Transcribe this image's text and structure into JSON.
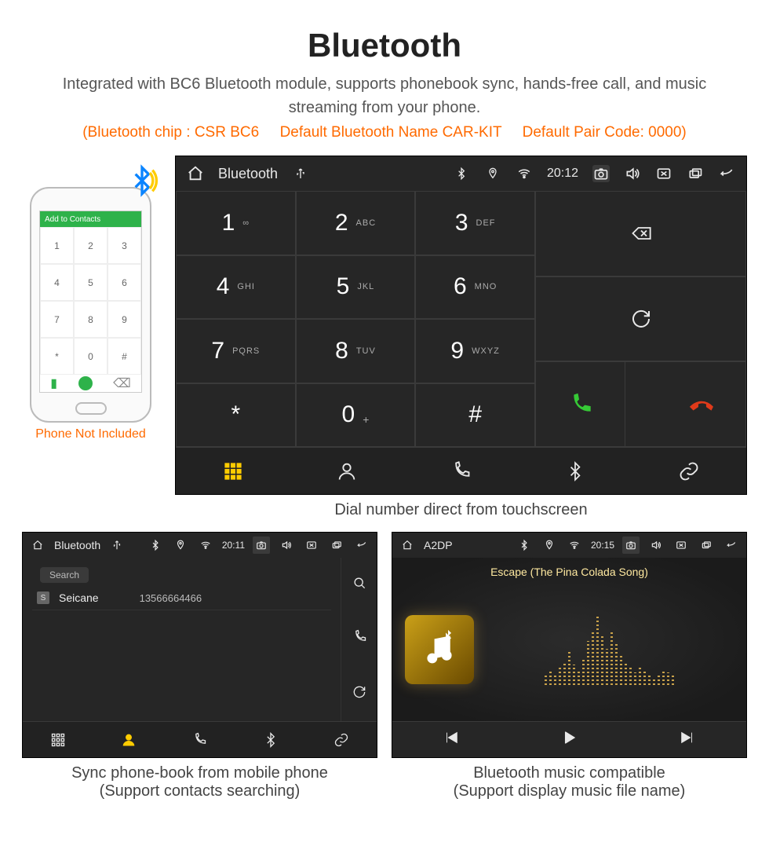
{
  "header": {
    "title": "Bluetooth",
    "subtitle": "Integrated with BC6 Bluetooth module, supports phonebook sync, hands-free call, and music streaming from your phone.",
    "specline": "(Bluetooth chip : CSR BC6     Default Bluetooth Name CAR-KIT     Default Pair Code: 0000)"
  },
  "phone_mock": {
    "top_label": "Add to Contacts",
    "keys": [
      "1",
      "2",
      "3",
      "4",
      "5",
      "6",
      "7",
      "8",
      "9",
      "*",
      "0",
      "#"
    ],
    "caption": "Phone Not Included"
  },
  "dialer": {
    "statusbar": {
      "title": "Bluetooth",
      "time": "20:12"
    },
    "keys": [
      {
        "num": "1",
        "lbl": "∞"
      },
      {
        "num": "2",
        "lbl": "ABC"
      },
      {
        "num": "3",
        "lbl": "DEF"
      },
      {
        "num": "4",
        "lbl": "GHI"
      },
      {
        "num": "5",
        "lbl": "JKL"
      },
      {
        "num": "6",
        "lbl": "MNO"
      },
      {
        "num": "7",
        "lbl": "PQRS"
      },
      {
        "num": "8",
        "lbl": "TUV"
      },
      {
        "num": "9",
        "lbl": "WXYZ"
      },
      {
        "num": "*",
        "lbl": ""
      },
      {
        "num": "0",
        "lbl": "+"
      },
      {
        "num": "#",
        "lbl": ""
      }
    ],
    "caption": "Dial number direct from touchscreen"
  },
  "phonebook": {
    "statusbar": {
      "title": "Bluetooth",
      "time": "20:11"
    },
    "search_placeholder": "Search",
    "contacts": [
      {
        "badge": "S",
        "name": "Seicane",
        "number": "13566664466"
      }
    ],
    "caption_line1": "Sync phone-book from mobile phone",
    "caption_line2": "(Support contacts searching)"
  },
  "music": {
    "statusbar": {
      "title": "A2DP",
      "time": "20:15"
    },
    "song": "Escape (The Pina Colada Song)",
    "viz_heights": [
      12,
      18,
      14,
      22,
      30,
      44,
      26,
      18,
      32,
      56,
      70,
      88,
      62,
      46,
      70,
      52,
      40,
      30,
      22,
      16,
      24,
      18,
      14,
      10,
      14,
      20,
      16,
      12
    ],
    "caption_line1": "Bluetooth music compatible",
    "caption_line2": "(Support display music file name)"
  }
}
